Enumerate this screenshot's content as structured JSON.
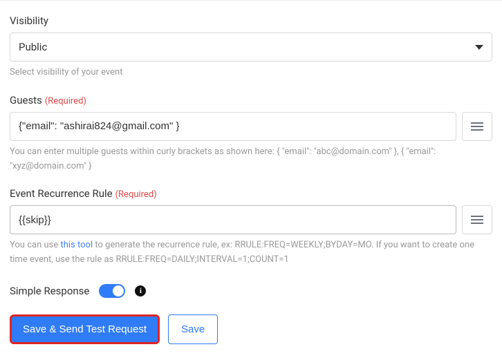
{
  "visibility": {
    "label": "Visibility",
    "value": "Public",
    "helper": "Select visibility of your event"
  },
  "guests": {
    "label": "Guests",
    "required_text": "(Required)",
    "value": "{\"email\": \"ashirai824@gmail.com\" }",
    "helper": "You can enter multiple guests within curly brackets as shown here: { \"email\": \"abc@domain.com\" }, { \"email\": \"xyz@domain.com\" }"
  },
  "recurrence": {
    "label": "Event Recurrence Rule",
    "required_text": "(Required)",
    "value": "{{skip}}",
    "helper_pre": "You can use ",
    "helper_link": "this tool",
    "helper_post": " to generate the recurrence rule, ex: RRULE:FREQ=WEEKLY;BYDAY=MO. If you want to create one time event, use the rule as RRULE:FREQ=DAILY;INTERVAL=1;COUNT=1"
  },
  "simple_response": {
    "label": "Simple Response"
  },
  "buttons": {
    "save_send": "Save & Send Test Request",
    "save": "Save"
  }
}
